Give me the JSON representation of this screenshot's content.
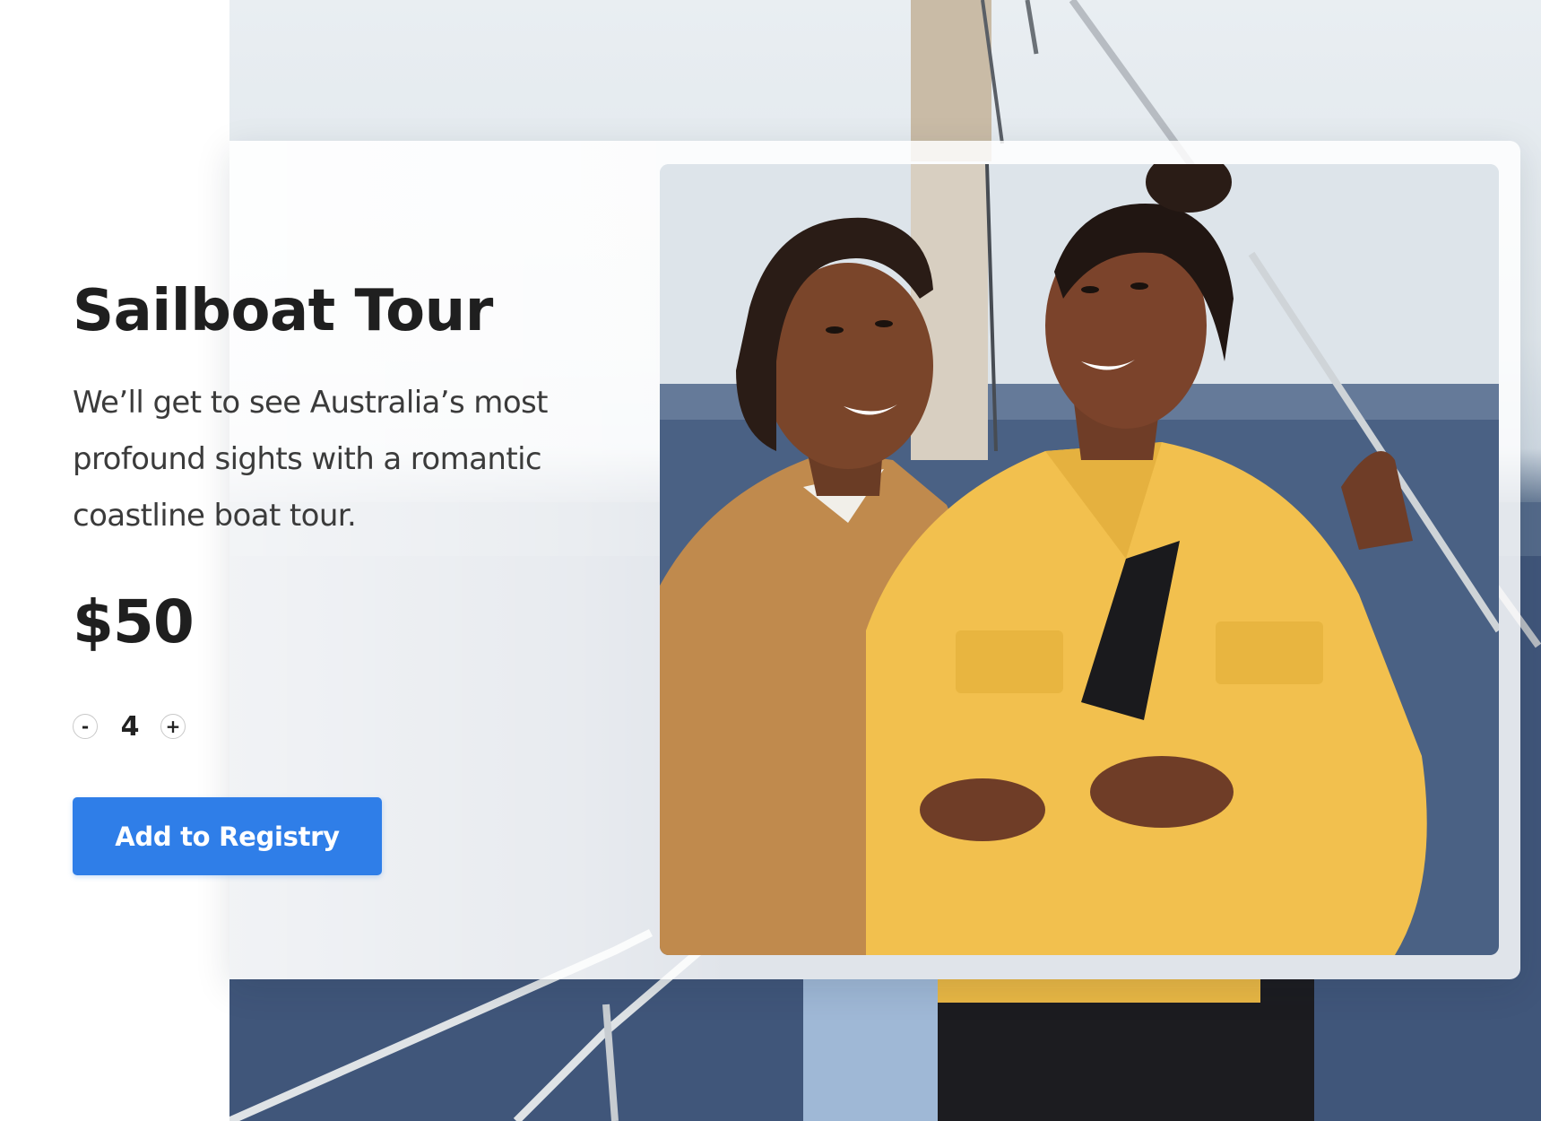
{
  "product": {
    "title": "Sailboat Tour",
    "description": "We’ll get to see Australia’s most profound sights with a romantic coastline boat tour.",
    "price": "$50"
  },
  "quantity": {
    "decrement_label": "-",
    "value": "4",
    "increment_label": "+"
  },
  "actions": {
    "add_to_registry_label": "Add to Registry"
  },
  "colors": {
    "accent": "#2f7ee8",
    "text_dark": "#1f1f1f",
    "text_body": "#3b3b3b",
    "sea": "#41577a",
    "yellow_jacket": "#f2c04e",
    "brown_jacket": "#c08a4d"
  }
}
